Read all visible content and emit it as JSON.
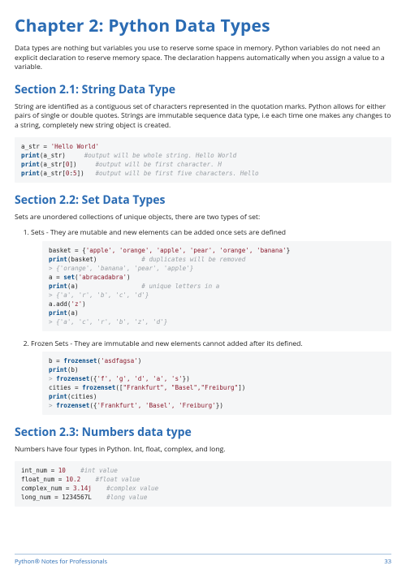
{
  "chapter": {
    "title": "Chapter 2: Python Data Types"
  },
  "intro": "Data types are nothing but variables you use to reserve some space in memory. Python variables do not need an explicit declaration to reserve memory space. The declaration happens automatically when you assign a value to a variable.",
  "sections": {
    "s1": {
      "title": "Section 2.1: String Data Type",
      "body": "String are identified as a contiguous set of characters represented in the quotation marks. Python allows for either pairs of single or double quotes. Strings are immutable sequence data type, i.e each time one makes any changes to a string, completely new string object is created."
    },
    "s2": {
      "title": "Section 2.2: Set Data Types",
      "body": "Sets are unordered collections of unique objects, there are two types of set:",
      "li1": "Sets - They are mutable and new elements can be added once sets are defined",
      "li2": "Frozen Sets - They are immutable and new elements cannot added after its defined."
    },
    "s3": {
      "title": "Section 2.3: Numbers data type",
      "body": "Numbers have four types in Python. Int, float, complex, and long."
    }
  },
  "code": {
    "c1": {
      "l1a": "a_str = ",
      "l1s": "'Hello World'",
      "l2a": "print",
      "l2b": "(a_str)     ",
      "l2c": "#output will be whole string. Hello World",
      "l3a": "print",
      "l3b": "(a_str[",
      "l3n": "0",
      "l3c": "])     ",
      "l3d": "#output will be first character. H",
      "l4a": "print",
      "l4b": "(a_str[",
      "l4n1": "0",
      "l4c": ":",
      "l4n2": "5",
      "l4d": "])   ",
      "l4e": "#output will be first five characters. Hello"
    },
    "c2": {
      "l1a": "basket = {",
      "l1s": "'apple', 'orange', 'apple', 'pear', 'orange', 'banana'",
      "l1b": "}",
      "l2a": "print",
      "l2b": "(basket)            ",
      "l2c": "# duplicates will be removed",
      "l3": "> {'orange', 'banana', 'pear', 'apple'}",
      "l4a": "a = ",
      "l4f": "set",
      "l4b": "(",
      "l4s": "'abracadabra'",
      "l4c": ")",
      "l5a": "print",
      "l5b": "(a)                 ",
      "l5c": "# unique letters in a",
      "l6": "> {'a', 'r', 'b', 'c', 'd'}",
      "l7a": "a.add(",
      "l7s": "'z'",
      "l7b": ")",
      "l8a": "print",
      "l8b": "(a)",
      "l9": "> {'a', 'c', 'r', 'b', 'z', 'd'}"
    },
    "c3": {
      "l1a": "b = ",
      "l1f": "frozenset",
      "l1b": "(",
      "l1s": "'asdfagsa'",
      "l1c": ")",
      "l2a": "print",
      "l2b": "(b)",
      "l3a": "> ",
      "l3f": "frozenset",
      "l3b": "({",
      "l3s": "'f', 'g', 'd', 'a', 's'",
      "l3c": "})",
      "l4a": "cities = ",
      "l4f": "frozenset",
      "l4b": "([",
      "l4s": "\"Frankfurt\", \"Basel\",\"Freiburg\"",
      "l4c": "])",
      "l5a": "print",
      "l5b": "(cities)",
      "l6a": "> ",
      "l6f": "frozenset",
      "l6b": "({",
      "l6s": "'Frankfurt', 'Basel', 'Freiburg'",
      "l6c": "})"
    },
    "c4": {
      "l1a": "int_num = ",
      "l1n": "10",
      "l1c": "    #int value",
      "l2a": "float_num = ",
      "l2n": "10.2",
      "l2c": "    #float value",
      "l3a": "complex_num = ",
      "l3n": "3.14j",
      "l3c": "    #complex value",
      "l4a": "long_num = 1234567L    ",
      "l4c": "#long value"
    }
  },
  "footer": {
    "left": "Python® Notes for Professionals",
    "right": "33"
  }
}
